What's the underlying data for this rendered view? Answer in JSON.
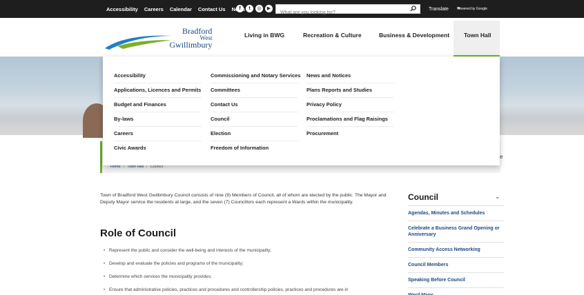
{
  "topbar": {
    "links": [
      "Accessibility",
      "Careers",
      "Calendar",
      "Contact Us",
      "News"
    ],
    "social_icons": [
      "facebook-icon",
      "twitter-icon",
      "instagram-icon",
      "youtube-icon"
    ],
    "search_placeholder": "What are you looking for?",
    "translate_label": "Translate",
    "translate_chevron": "▼",
    "powered_by": "Powered by Google"
  },
  "logo": {
    "line1": "Bradford",
    "line2": "West",
    "line3": "Gwillimbury",
    "colors": {
      "blue": "#1f7fc4",
      "green": "#7ab02b",
      "text": "#1b4a7d"
    }
  },
  "mainnav": {
    "items": [
      "Living in BWG",
      "Recreation & Culture",
      "Business & Development",
      "Town Hall"
    ],
    "active": "Town Hall",
    "accent": "#6ab023"
  },
  "megamenu": {
    "col1": [
      "Accessibility",
      "Applications, Licences and Permits",
      "Budget and Finances",
      "By-laws",
      "Careers",
      "Civic Awards"
    ],
    "col2": [
      "Commissioning and Notary Services",
      "Committees",
      "Contact Us",
      "Council",
      "Election",
      "Freedom of Information"
    ],
    "col3": [
      "News and Notices",
      "Plans Reports and Studies",
      "Privacy Policy",
      "Proclamations and Flag Raisings",
      "Procurement"
    ]
  },
  "breadcrumb": {
    "items": [
      "Home",
      "Town Hall",
      "Council"
    ],
    "sep": "/"
  },
  "stray_text": "e",
  "intro": "Town of Bradford West Gwillimbury Council consists of nine (9) Members of Council, all of whom are elected by the public. The Mayor and Deputy Mayor service the residents at large, and the seven (7) Councillors each represent a Wards within the municipality.",
  "role": {
    "heading": "Role of Council",
    "bullet": "•",
    "bullets": [
      "Represent the public and consider the well-being and interests of the municipality;",
      "Develop and evaluate the policies and programs of the municipality;",
      "Determine which services the municipality provides;",
      "Ensure that administrative policies, practices and procedures and controllership policies, practices and procedures are in"
    ]
  },
  "sidebar": {
    "title": "Council",
    "chevron": "⌄",
    "links": [
      "Agendas, Minutes and Schedules",
      "Celebrate a Business Grand Opening or Anniversary",
      "Community Access Networking",
      "Council Members",
      "Speaking Before Council",
      "Ward Maps"
    ]
  },
  "search_icon_glyph": "⚲"
}
